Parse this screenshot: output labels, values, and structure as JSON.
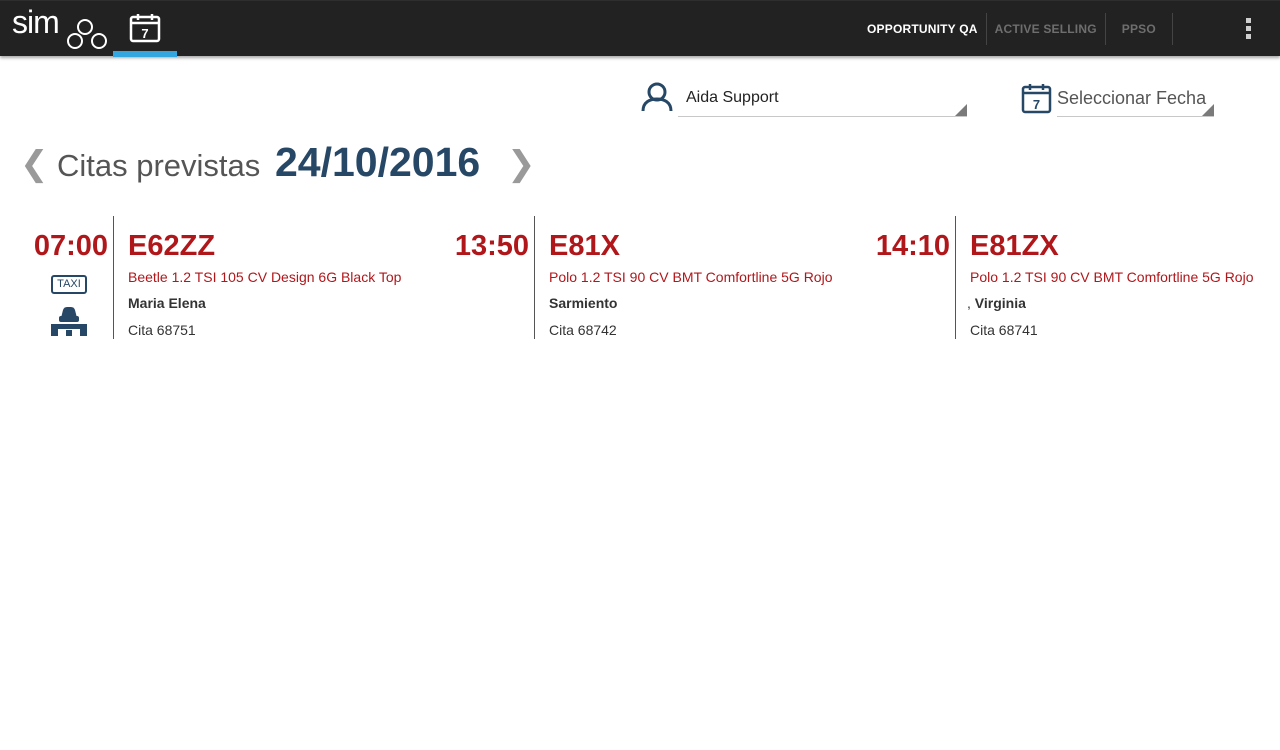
{
  "app": {
    "logo_text": "simgo"
  },
  "topnav": {
    "items": [
      {
        "label": "OPPORTUNITY QA"
      },
      {
        "label": "ACTIVE SELLING"
      },
      {
        "label": "PPSO"
      }
    ]
  },
  "filters": {
    "user": {
      "value": "Aida Support"
    },
    "date": {
      "value": "Seleccionar Fecha"
    }
  },
  "heading": {
    "label": "Citas previstas",
    "date": "24/10/2016",
    "prev_glyph": "❮",
    "next_glyph": "❯"
  },
  "appointments": [
    {
      "time": "07:00",
      "plate": "E62ZZ",
      "model": "Beetle 1.2 TSI 105 CV Design 6G Black Top",
      "customer_prefix": "",
      "customer": "Maria Elena",
      "cita": "Cita 68751",
      "badge": "TAXI",
      "icons": [
        "taxi-badge-icon",
        "car-lift-icon"
      ]
    },
    {
      "time": "13:50",
      "plate": "E81X",
      "model": "Polo 1.2 TSI 90 CV BMT Comfortline 5G Rojo",
      "customer_prefix": "",
      "customer": "Sarmiento",
      "cita": "Cita 68742"
    },
    {
      "time": "14:10",
      "plate": "E81ZX",
      "model": "Polo 1.2 TSI 90 CV BMT Comfortline 5G Rojo",
      "customer_prefix": ", ",
      "customer": "Virginia",
      "cita": "Cita 68741"
    }
  ],
  "colors": {
    "appbar": "#222222",
    "accent_tab": "#33a6df",
    "brand_dark": "#264866",
    "appointment_red": "#b0171b"
  }
}
